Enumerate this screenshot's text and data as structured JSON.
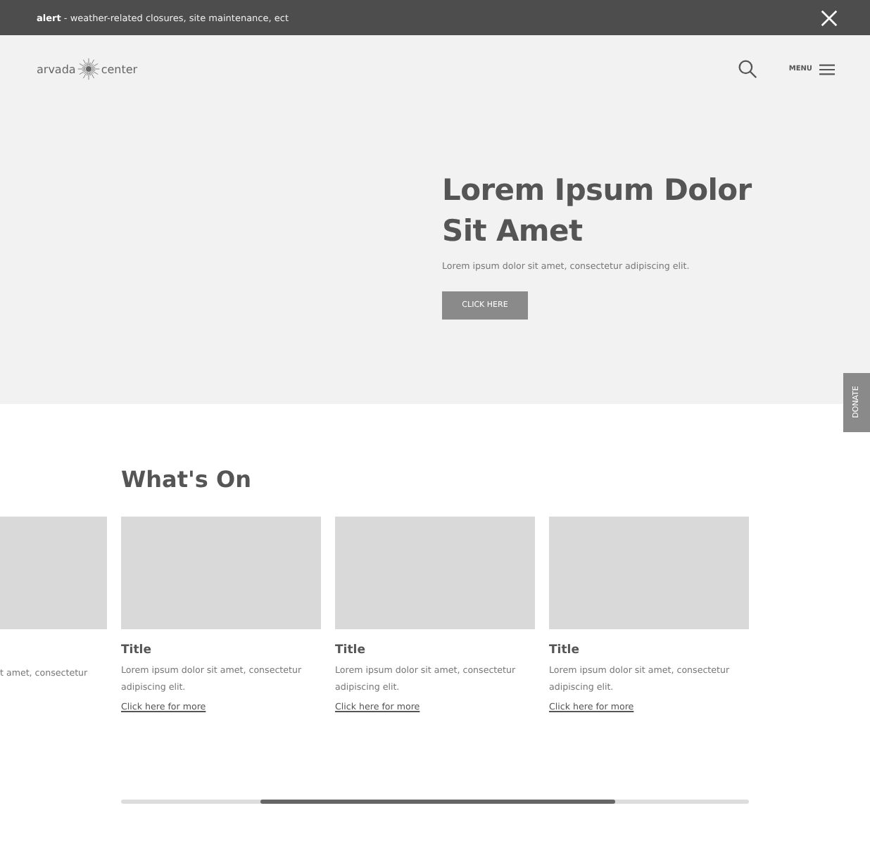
{
  "alert": {
    "label": "alert",
    "text": " - weather-related closures, site maintenance, ect"
  },
  "header": {
    "logo_left": "arvada",
    "logo_right": "center",
    "menu": "MENU"
  },
  "hero": {
    "title": "Lorem Ipsum Dolor Sit Amet",
    "text": "Lorem ipsum dolor sit amet, consectetur adipiscing elit.",
    "button": "CLICK HERE"
  },
  "donate": "DONATE",
  "section": {
    "title": "What's On",
    "cards": [
      {
        "text": "t amet, consectetur",
        "partial": true
      },
      {
        "title": "Title",
        "text": "Lorem ipsum dolor sit amet, consectetur adipiscing elit.",
        "link": "Click here for more",
        "partial": false
      },
      {
        "title": "Title",
        "text": "Lorem ipsum dolor sit amet, consectetur adipiscing elit.",
        "link": "Click here for more",
        "partial": false
      },
      {
        "title": "Title",
        "text": "Lorem ipsum dolor sit amet, consectetur adipiscing elit.",
        "link": "Click here for more",
        "partial": false
      }
    ]
  }
}
